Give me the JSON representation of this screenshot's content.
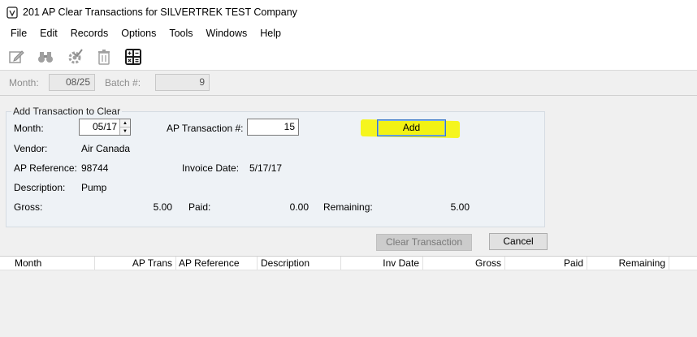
{
  "window": {
    "title": "201 AP Clear Transactions for SILVERTREK TEST Company",
    "icon": "app-icon"
  },
  "menu": [
    "File",
    "Edit",
    "Records",
    "Options",
    "Tools",
    "Windows",
    "Help"
  ],
  "toolbar": [
    "edit-icon",
    "binoculars-icon",
    "settings-check-icon",
    "trash-icon",
    "calculator-icon"
  ],
  "batch": {
    "month_label": "Month:",
    "month_value": "08/25",
    "batch_label": "Batch #:",
    "batch_value": "9"
  },
  "form": {
    "legend": "Add Transaction to Clear",
    "month_label": "Month:",
    "month_value": "05/17",
    "ap_trans_label": "AP Transaction #:",
    "ap_trans_value": "15",
    "add_button": "Add",
    "vendor_label": "Vendor:",
    "vendor_value": "Air Canada",
    "ap_ref_label": "AP Reference:",
    "ap_ref_value": "98744",
    "invoice_date_label": "Invoice Date:",
    "invoice_date_value": "5/17/17",
    "description_label": "Description:",
    "description_value": "Pump",
    "gross_label": "Gross:",
    "gross_value": "5.00",
    "paid_label": "Paid:",
    "paid_value": "0.00",
    "remaining_label": "Remaining:",
    "remaining_value": "5.00"
  },
  "buttons": {
    "clear": "Clear Transaction",
    "cancel": "Cancel"
  },
  "grid": {
    "columns": [
      "Month",
      "AP Trans",
      "AP Reference",
      "Description",
      "Inv Date",
      "Gross",
      "Paid",
      "Remaining"
    ]
  },
  "colors": {
    "highlight": "#f5f51e",
    "add_button": "#f2f214"
  }
}
